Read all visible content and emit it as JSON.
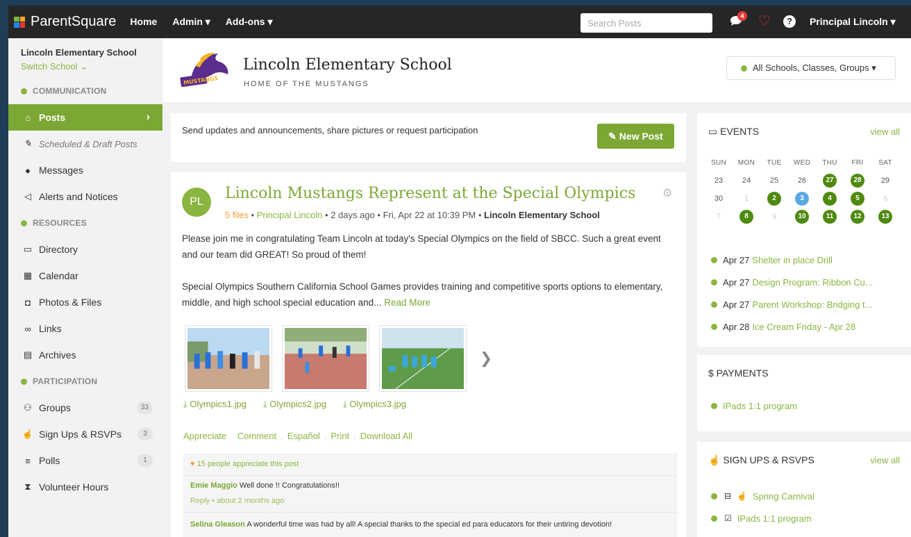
{
  "app": {
    "brand": "ParentSquare"
  },
  "topnav": {
    "items": [
      "Home",
      "Admin ▾",
      "Add-ons ▾"
    ],
    "search_placeholder": "Search Posts",
    "notification_count": "4",
    "user": "Principal Lincoln ▾",
    "help": "?"
  },
  "sidebar": {
    "school_name": "Lincoln Elementary School",
    "switch_school": "Switch School ⌄",
    "sections": {
      "communication": "COMMUNICATION",
      "resources": "RESOURCES",
      "participation": "PARTICIPATION"
    },
    "items": {
      "posts": "Posts",
      "drafts": "Scheduled & Draft Posts",
      "messages": "Messages",
      "alerts": "Alerts and Notices",
      "directory": "Directory",
      "calendar": "Calendar",
      "photos": "Photos & Files",
      "links": "Links",
      "archives": "Archives",
      "groups": "Groups",
      "signups": "Sign Ups & RSVPs",
      "polls": "Polls",
      "volunteer": "Volunteer Hours"
    },
    "counts": {
      "groups": "33",
      "signups": "3",
      "polls": "1"
    }
  },
  "school_header": {
    "title": "Lincoln Elementary School",
    "subtitle": "HOME OF THE MUSTANGS",
    "scope": "All Schools, Classes, Groups ▾"
  },
  "composer": {
    "prompt": "Send updates and announcements, share pictures or request participation",
    "button": "✎ New Post"
  },
  "post": {
    "avatar": "PL",
    "title": "Lincoln Mustangs Represent at the Special Olympics",
    "files": "5 files",
    "author": "Principal Lincoln",
    "time": " • 2 days ago • Fri, Apr 22 at 10:39 PM • ",
    "school": "Lincoln Elementary School",
    "sep1": " • ",
    "body1": "Please join me in congratulating Team Lincoln at today's Special Olympics on the field of SBCC.  Such a great event and our team did GREAT!  So proud of them!",
    "body2": "Special Olympics Southern California School Games provides training and competitive sports options to elementary, middle, and high school special education and... ",
    "read_more": "Read More",
    "files_list": [
      "⤓ Olympics1.jpg",
      "⤓ Olympics2.jpg",
      "⤓ Olympics3.jpg"
    ],
    "actions": [
      "Appreciate",
      "Comment",
      "Español",
      "Print",
      "Download All"
    ],
    "action_sep": ".",
    "appreciate_text": "15 people appreciate this post",
    "comments": [
      {
        "name": "Emie Maggio",
        "text": " Well done !! Congratulations!!",
        "meta": "Reply • about 2 months ago"
      },
      {
        "name": "Selina Gleason",
        "text": " A wonderful time was had by all! A special thanks to the special ed para educators for their untiring devotion!"
      }
    ]
  },
  "events": {
    "title": "EVENTS",
    "view_all": "view all",
    "weekdays": [
      "SUN",
      "MON",
      "TUE",
      "WED",
      "THU",
      "FRI",
      "SAT"
    ],
    "list": [
      {
        "date": "Apr 27",
        "name": "Shelter in place Drill"
      },
      {
        "date": "Apr 27",
        "name": "Design Program: Ribbon Cu..."
      },
      {
        "date": "Apr 27",
        "name": "Parent Workshop: Bridging t..."
      },
      {
        "date": "Apr 28",
        "name": "Ice Cream Friday - Apr 28"
      }
    ]
  },
  "calendar": {
    "weeks": [
      [
        "23",
        "24",
        "25",
        "26",
        "27",
        "28",
        "29"
      ],
      [
        "30",
        "1",
        "2",
        "3",
        "4",
        "5",
        "6"
      ],
      [
        "7",
        "8",
        "9",
        "10",
        "11",
        "12",
        "13"
      ]
    ]
  },
  "payments": {
    "title": "$ PAYMENTS",
    "items": [
      "IPads 1:1 program"
    ]
  },
  "signups": {
    "title": "SIGN UPS & RSVPS",
    "view_all": "view all",
    "items": [
      "Spring Carnival",
      "IPads 1:1 program"
    ]
  },
  "colors": {
    "brand_green": "#7ca734",
    "topbar": "#262626",
    "alert_red": "#e53935",
    "today_blue": "#5ba9e4"
  }
}
